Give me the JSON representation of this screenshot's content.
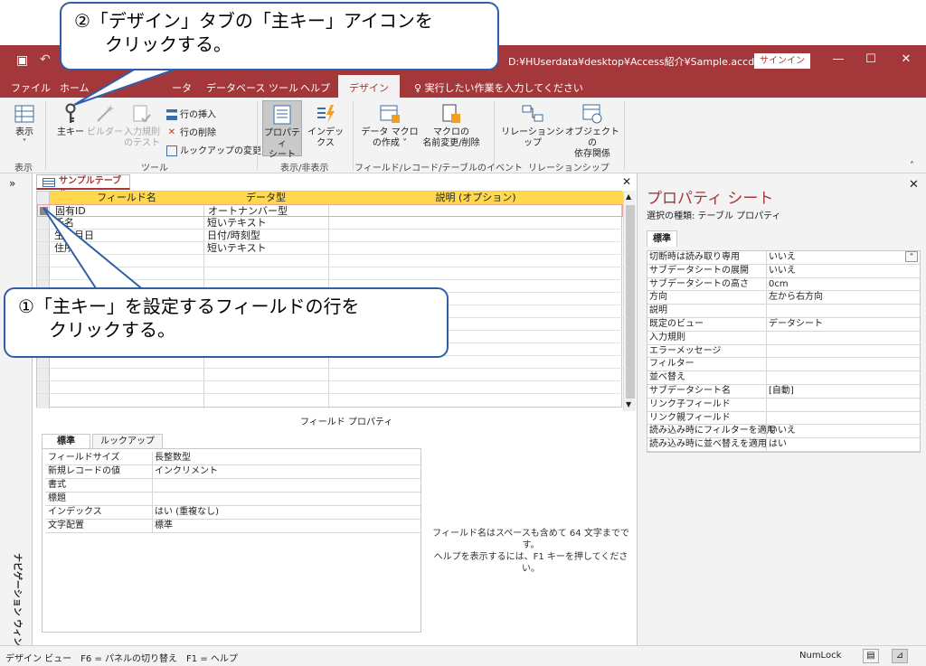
{
  "titlebar": {
    "path": "D:¥HUserdata¥desktop¥Access紹介¥Sample.accd···",
    "signin": "サインイン",
    "minimize": "—",
    "maximize": "☐",
    "close": "✕"
  },
  "tabs": {
    "file": "ファイル",
    "home": "ホーム",
    "create_partial": "作",
    "external_partial": "ータ",
    "dbtools": "データベース ツール",
    "help": "ヘルプ",
    "design": "デザイン",
    "tellme": "実行したい作業を入力してください"
  },
  "ribbon": {
    "view": "表示",
    "view_group": "表示",
    "primary_key": "主キー",
    "builder": "ビルダー",
    "test_rules_1": "入力規則",
    "test_rules_2": "のテスト",
    "insert_rows": "行の挿入",
    "delete_rows": "行の削除",
    "modify_lookups": "ルックアップの変更",
    "tools_group": "ツール",
    "property_sheet_1": "プロパティ",
    "property_sheet_2": "シート",
    "indexes": "インデックス",
    "showhide_group": "表示/非表示",
    "create_macro_1": "データ マクロ",
    "create_macro_2": "の作成 ˅",
    "rename_macro_1": "マクロの",
    "rename_macro_2": "名前変更/削除",
    "events_group": "フィールド/レコード/テーブルのイベント",
    "relationships": "リレーションシップ",
    "obj_dep_1": "オブジェクトの",
    "obj_dep_2": "依存関係",
    "rel_group": "リレーションシップ"
  },
  "nav": {
    "chevron": "»",
    "label": "ナビゲーション ウィンドウ"
  },
  "document": {
    "tab": "サンプルテーブル",
    "close": "✕",
    "headers": [
      "フィールド名",
      "データ型",
      "説明 (オプション)"
    ],
    "rows": [
      {
        "field": "固有ID",
        "type": "オートナンバー型"
      },
      {
        "field": "氏名",
        "type": "短いテキスト"
      },
      {
        "field": "生年月日",
        "type": "日付/時刻型"
      },
      {
        "field": "住所",
        "type": "短いテキスト"
      }
    ]
  },
  "field_props": {
    "title": "フィールド プロパティ",
    "tab_general": "標準",
    "tab_lookup": "ルックアップ",
    "rows": [
      {
        "k": "フィールドサイズ",
        "v": "長整数型"
      },
      {
        "k": "新規レコードの値",
        "v": "インクリメント"
      },
      {
        "k": "書式",
        "v": ""
      },
      {
        "k": "標題",
        "v": ""
      },
      {
        "k": "インデックス",
        "v": "はい (重複なし)"
      },
      {
        "k": "文字配置",
        "v": "標準"
      }
    ],
    "help_1": "フィールド名はスペースも含めて 64 文字までです。",
    "help_2": "ヘルプを表示するには、F1 キーを押してください。"
  },
  "property_sheet": {
    "title": "プロパティ シート",
    "subtitle": "選択の種類: テーブル プロパティ",
    "close": "✕",
    "tab": "標準",
    "rows": [
      {
        "k": "切断時は読み取り専用",
        "v": "いいえ"
      },
      {
        "k": "サブデータシートの展開",
        "v": "いいえ"
      },
      {
        "k": "サブデータシートの高さ",
        "v": "0cm"
      },
      {
        "k": "方向",
        "v": "左から右方向"
      },
      {
        "k": "説明",
        "v": ""
      },
      {
        "k": "既定のビュー",
        "v": "データシート"
      },
      {
        "k": "入力規則",
        "v": ""
      },
      {
        "k": "エラーメッセージ",
        "v": ""
      },
      {
        "k": "フィルター",
        "v": ""
      },
      {
        "k": "並べ替え",
        "v": ""
      },
      {
        "k": "サブデータシート名",
        "v": "[自動]"
      },
      {
        "k": "リンク子フィールド",
        "v": ""
      },
      {
        "k": "リンク親フィールド",
        "v": ""
      },
      {
        "k": "読み込み時にフィルターを適用",
        "v": "いいえ"
      },
      {
        "k": "読み込み時に並べ替えを適用",
        "v": "はい"
      }
    ]
  },
  "status": {
    "text": "デザイン ビュー　F6 = パネルの切り替え　F1 = ヘルプ",
    "numlock": "NumLock"
  },
  "callouts": {
    "step2_line1": "②「デザイン」タブの「主キー」アイコンを",
    "step2_line2": "クリックする。",
    "step1_line1": "①「主キー」を設定するフィールドの行を",
    "step1_line2": "クリックする。"
  },
  "colors": {
    "accent": "#a4373a",
    "header": "#ffd84d",
    "callout_border": "#2e5fa8"
  }
}
